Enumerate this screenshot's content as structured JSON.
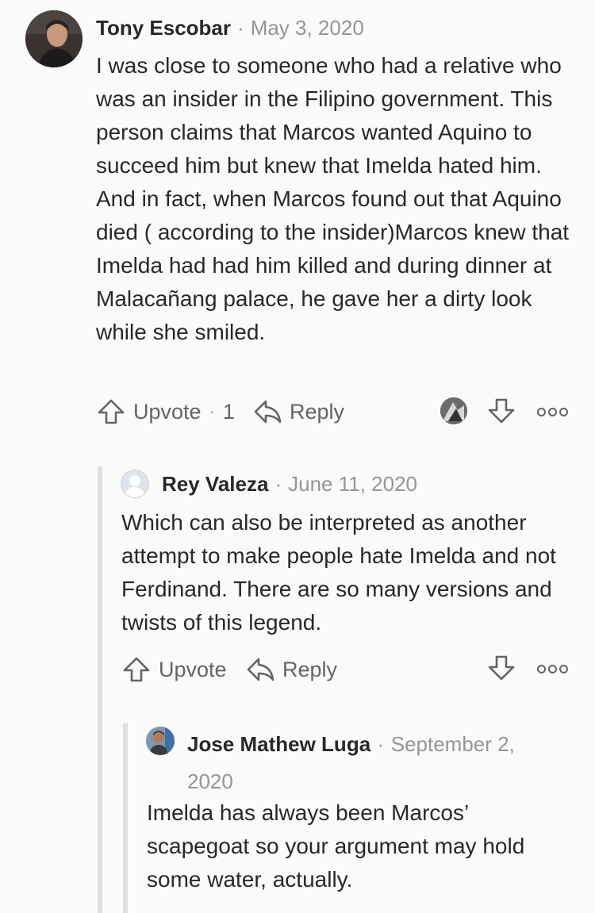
{
  "comments": [
    {
      "author": "Tony Escobar",
      "separator": "·",
      "date": "May 3, 2020",
      "body": "I was close to someone who had a relative who was an insider in the Filipino government. This person claims that Marcos wanted Aquino to succeed him but knew that Imelda hated him. And in fact, when Marcos found out that Aquino died ( according to the insider)Marcos knew that Imelda had had him killed and during dinner at Malacañang palace, he gave her a dirty look while she smiled.",
      "upvote_label": "Upvote",
      "upvote_sep": "·",
      "upvote_count": "1",
      "reply_label": "Reply"
    },
    {
      "author": "Rey Valeza",
      "separator": "·",
      "date": "June 11, 2020",
      "body": "Which can also be interpreted as another attempt to make people hate Imelda and not Ferdinand. There are so many versions and twists of this legend.",
      "upvote_label": "Upvote",
      "reply_label": "Reply"
    },
    {
      "author": "Jose Mathew Luga",
      "separator": "·",
      "date_part1": "September 2,",
      "date_part2": "2020",
      "body": "Imelda has always been Marcos’ scapegoat so your argument may hold some water, actually."
    }
  ],
  "colors": {
    "background": "#fafafa",
    "text": "#282829",
    "muted": "#939598",
    "icon": "#636466",
    "thread_line": "#dedfe0"
  },
  "icons": [
    "upvote-icon",
    "reply-icon",
    "downvote-icon",
    "more-icon",
    "avatar"
  ]
}
